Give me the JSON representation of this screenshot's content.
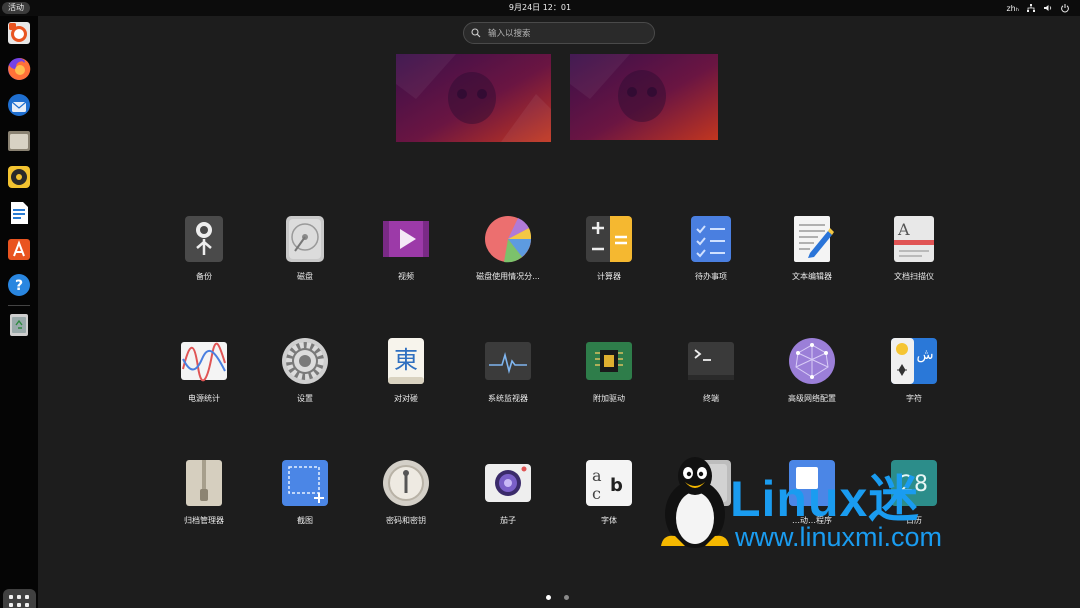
{
  "topbar": {
    "activities": "活动",
    "clock": "9月24日 12：01",
    "lang": "zhₕ",
    "icons": [
      "network-icon",
      "volume-icon",
      "power-icon"
    ]
  },
  "dock": {
    "apps": [
      "software-updater",
      "firefox",
      "thunderbird",
      "files",
      "rhythmbox",
      "libreoffice-writer",
      "app-center",
      "help"
    ],
    "trash": "trash"
  },
  "search": {
    "placeholder": "输入以搜索"
  },
  "apps": [
    {
      "label": "备份",
      "icon": "backup-icon"
    },
    {
      "label": "磁盘",
      "icon": "disks-icon"
    },
    {
      "label": "视频",
      "icon": "videos-icon"
    },
    {
      "label": "磁盘使用情况分...",
      "icon": "disk-usage-icon"
    },
    {
      "label": "计算器",
      "icon": "calculator-icon"
    },
    {
      "label": "待办事项",
      "icon": "todo-icon"
    },
    {
      "label": "文本编辑器",
      "icon": "text-editor-icon"
    },
    {
      "label": "文档扫描仪",
      "icon": "document-scanner-icon"
    },
    {
      "label": "电源统计",
      "icon": "power-statistics-icon"
    },
    {
      "label": "设置",
      "icon": "settings-icon"
    },
    {
      "label": "对对碰",
      "icon": "mahjongg-icon"
    },
    {
      "label": "系统监视器",
      "icon": "system-monitor-icon"
    },
    {
      "label": "附加驱动",
      "icon": "additional-drivers-icon"
    },
    {
      "label": "终端",
      "icon": "terminal-icon"
    },
    {
      "label": "高级网络配置",
      "icon": "network-config-icon"
    },
    {
      "label": "字符",
      "icon": "characters-icon"
    },
    {
      "label": "归档管理器",
      "icon": "archive-manager-icon"
    },
    {
      "label": "截图",
      "icon": "screenshot-icon"
    },
    {
      "label": "密码和密钥",
      "icon": "passwords-keys-icon"
    },
    {
      "label": "茄子",
      "icon": "cheese-icon"
    },
    {
      "label": "字体",
      "icon": "fonts-icon"
    },
    {
      "label": "…器",
      "icon": "partial-icon"
    },
    {
      "label": "…动…程序",
      "icon": "startup-apps-icon"
    },
    {
      "label": "日历",
      "icon": "calendar-icon"
    }
  ],
  "pages": {
    "current": 1,
    "total": 2
  },
  "watermark": {
    "title": "Linux迷",
    "url": "www.linuxmi.com"
  }
}
